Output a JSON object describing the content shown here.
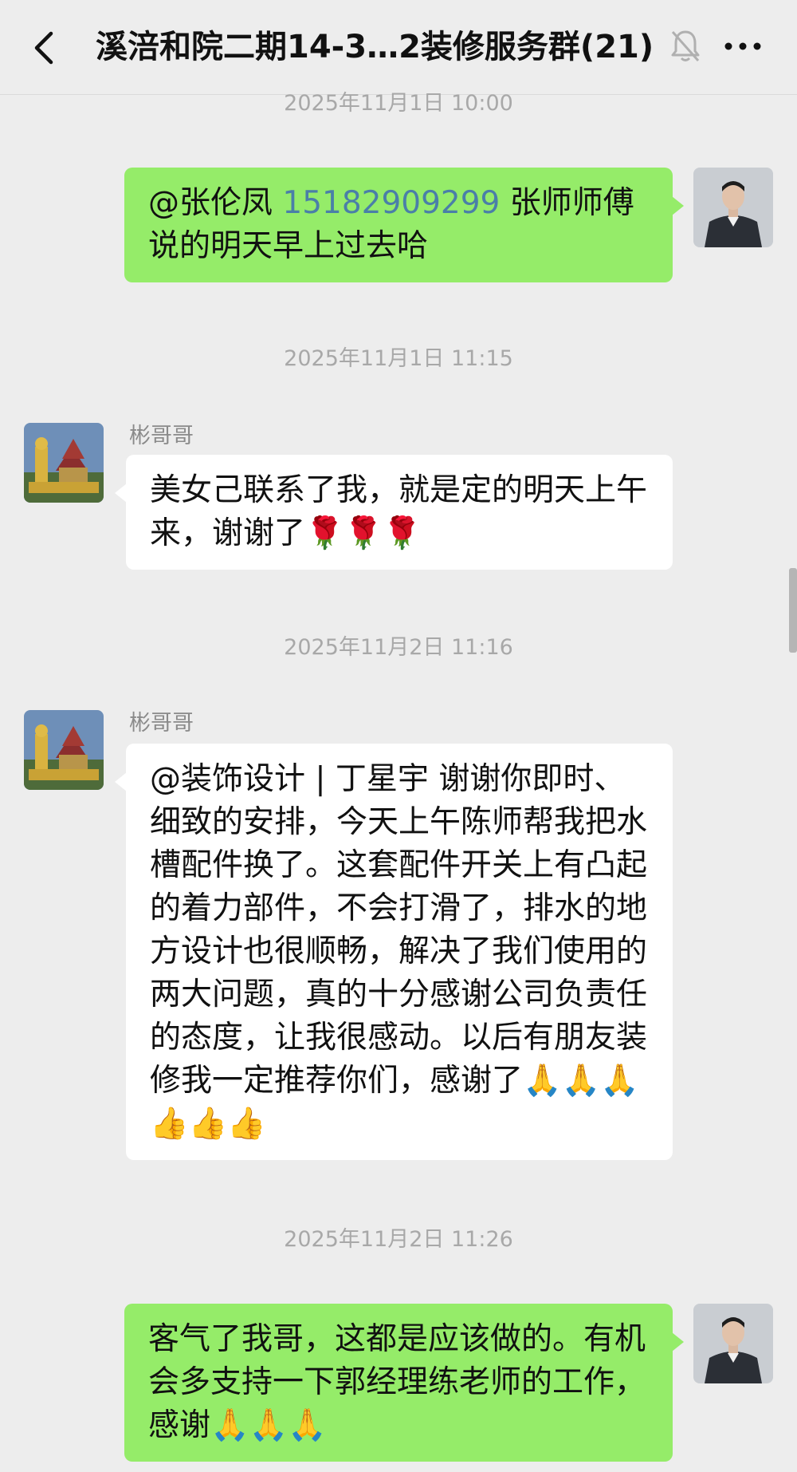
{
  "header": {
    "title": "溪涪和院二期14-3…2装修服务群(21)",
    "back_icon": "chevron-left-icon",
    "mute_icon": "bell-off-icon",
    "more_icon": "more-dots-icon"
  },
  "colors": {
    "background": "#EDEDED",
    "outgoing_bubble": "#95EC69",
    "incoming_bubble": "#FFFFFF",
    "timestamp": "#A8A8A8",
    "phone_link": "#4A7FA8"
  },
  "messages": [
    {
      "timestamp": "2025年11月1日 10:00",
      "direction": "outgoing",
      "mention": "@张伦凤 ",
      "phone": "15182909299",
      "text_after": " 张师师傅说的明天早上过去哈"
    },
    {
      "timestamp": "2025年11月1日 11:15",
      "direction": "incoming",
      "sender": "彬哥哥",
      "text": "美女己联系了我，就是定的明天上午来，谢谢了🌹🌹🌹"
    },
    {
      "timestamp": "2025年11月2日 11:16",
      "direction": "incoming",
      "sender": "彬哥哥",
      "text": "@装饰设计 | 丁星宇  谢谢你即时、细致的安排，今天上午陈师帮我把水槽配件换了。这套配件开关上有凸起的着力部件，不会打滑了，排水的地方设计也很顺畅，解决了我们使用的两大问题，真的十分感谢公司负责任的态度，让我很感动。以后有朋友装修我一定推荐你们，感谢了🙏🙏🙏👍👍👍"
    },
    {
      "timestamp": "2025年11月2日 11:26",
      "direction": "outgoing",
      "text": "客气了我哥，这都是应该做的。有机会多支持一下郭经理练老师的工作，感谢🙏🙏🙏"
    }
  ]
}
